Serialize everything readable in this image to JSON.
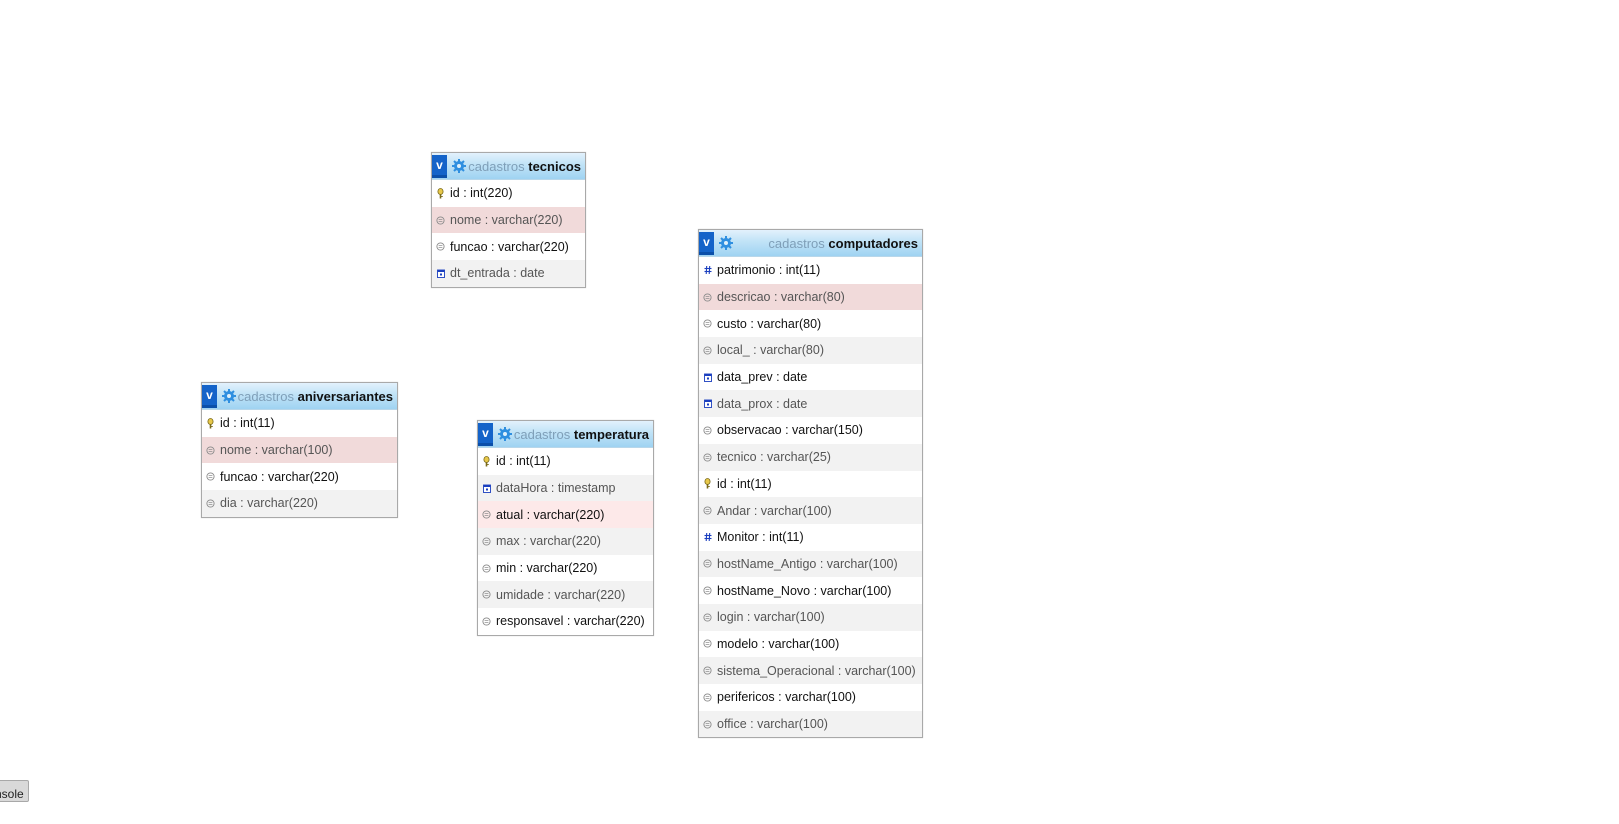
{
  "tables": {
    "tecnicos": {
      "toggle": "v",
      "db": "cadastros",
      "name": "tecnicos",
      "columns": [
        {
          "label": "id : int(220)",
          "icon": "key-icon"
        },
        {
          "label": "nome : varchar(220)",
          "icon": "text-icon"
        },
        {
          "label": "funcao : varchar(220)",
          "icon": "text-icon"
        },
        {
          "label": "dt_entrada : date",
          "icon": "date-icon"
        }
      ]
    },
    "computadores": {
      "toggle": "v",
      "db": "cadastros",
      "name": "computadores",
      "columns": [
        {
          "label": "patrimonio : int(11)",
          "icon": "number-icon"
        },
        {
          "label": "descricao : varchar(80)",
          "icon": "text-icon"
        },
        {
          "label": "custo : varchar(80)",
          "icon": "text-icon"
        },
        {
          "label": "local_ : varchar(80)",
          "icon": "text-icon"
        },
        {
          "label": "data_prev : date",
          "icon": "date-icon"
        },
        {
          "label": "data_prox : date",
          "icon": "date-icon"
        },
        {
          "label": "observacao : varchar(150)",
          "icon": "text-icon"
        },
        {
          "label": "tecnico : varchar(25)",
          "icon": "text-icon"
        },
        {
          "label": "id : int(11)",
          "icon": "key-icon"
        },
        {
          "label": "Andar : varchar(100)",
          "icon": "text-icon"
        },
        {
          "label": "Monitor : int(11)",
          "icon": "number-icon"
        },
        {
          "label": "hostName_Antigo : varchar(100)",
          "icon": "text-icon"
        },
        {
          "label": "hostName_Novo : varchar(100)",
          "icon": "text-icon"
        },
        {
          "label": "login : varchar(100)",
          "icon": "text-icon"
        },
        {
          "label": "modelo : varchar(100)",
          "icon": "text-icon"
        },
        {
          "label": "sistema_Operacional : varchar(100)",
          "icon": "text-icon"
        },
        {
          "label": "perifericos : varchar(100)",
          "icon": "text-icon"
        },
        {
          "label": "office : varchar(100)",
          "icon": "text-icon"
        }
      ]
    },
    "aniversariantes": {
      "toggle": "v",
      "db": "cadastros",
      "name": "aniversariantes",
      "columns": [
        {
          "label": "id : int(11)",
          "icon": "key-icon"
        },
        {
          "label": "nome : varchar(100)",
          "icon": "text-icon"
        },
        {
          "label": "funcao : varchar(220)",
          "icon": "text-icon"
        },
        {
          "label": "dia : varchar(220)",
          "icon": "text-icon"
        }
      ]
    },
    "temperatura": {
      "toggle": "v",
      "db": "cadastros",
      "name": "temperatura",
      "columns": [
        {
          "label": "id : int(11)",
          "icon": "key-icon"
        },
        {
          "label": "dataHora : timestamp",
          "icon": "date-icon"
        },
        {
          "label": "atual : varchar(220)",
          "icon": "text-icon"
        },
        {
          "label": "max : varchar(220)",
          "icon": "text-icon"
        },
        {
          "label": "min : varchar(220)",
          "icon": "text-icon"
        },
        {
          "label": "umidade : varchar(220)",
          "icon": "text-icon"
        },
        {
          "label": "responsavel : varchar(220)",
          "icon": "text-icon"
        }
      ]
    }
  },
  "console": {
    "label": "nsole"
  },
  "colors": {
    "header_gradient_top": "#e2f1fc",
    "header_gradient_bottom": "#9fd3f2",
    "toggle_blue": "#1463c9",
    "row_highlight": "#f1dada",
    "row_alt": "#f2f2f2"
  }
}
